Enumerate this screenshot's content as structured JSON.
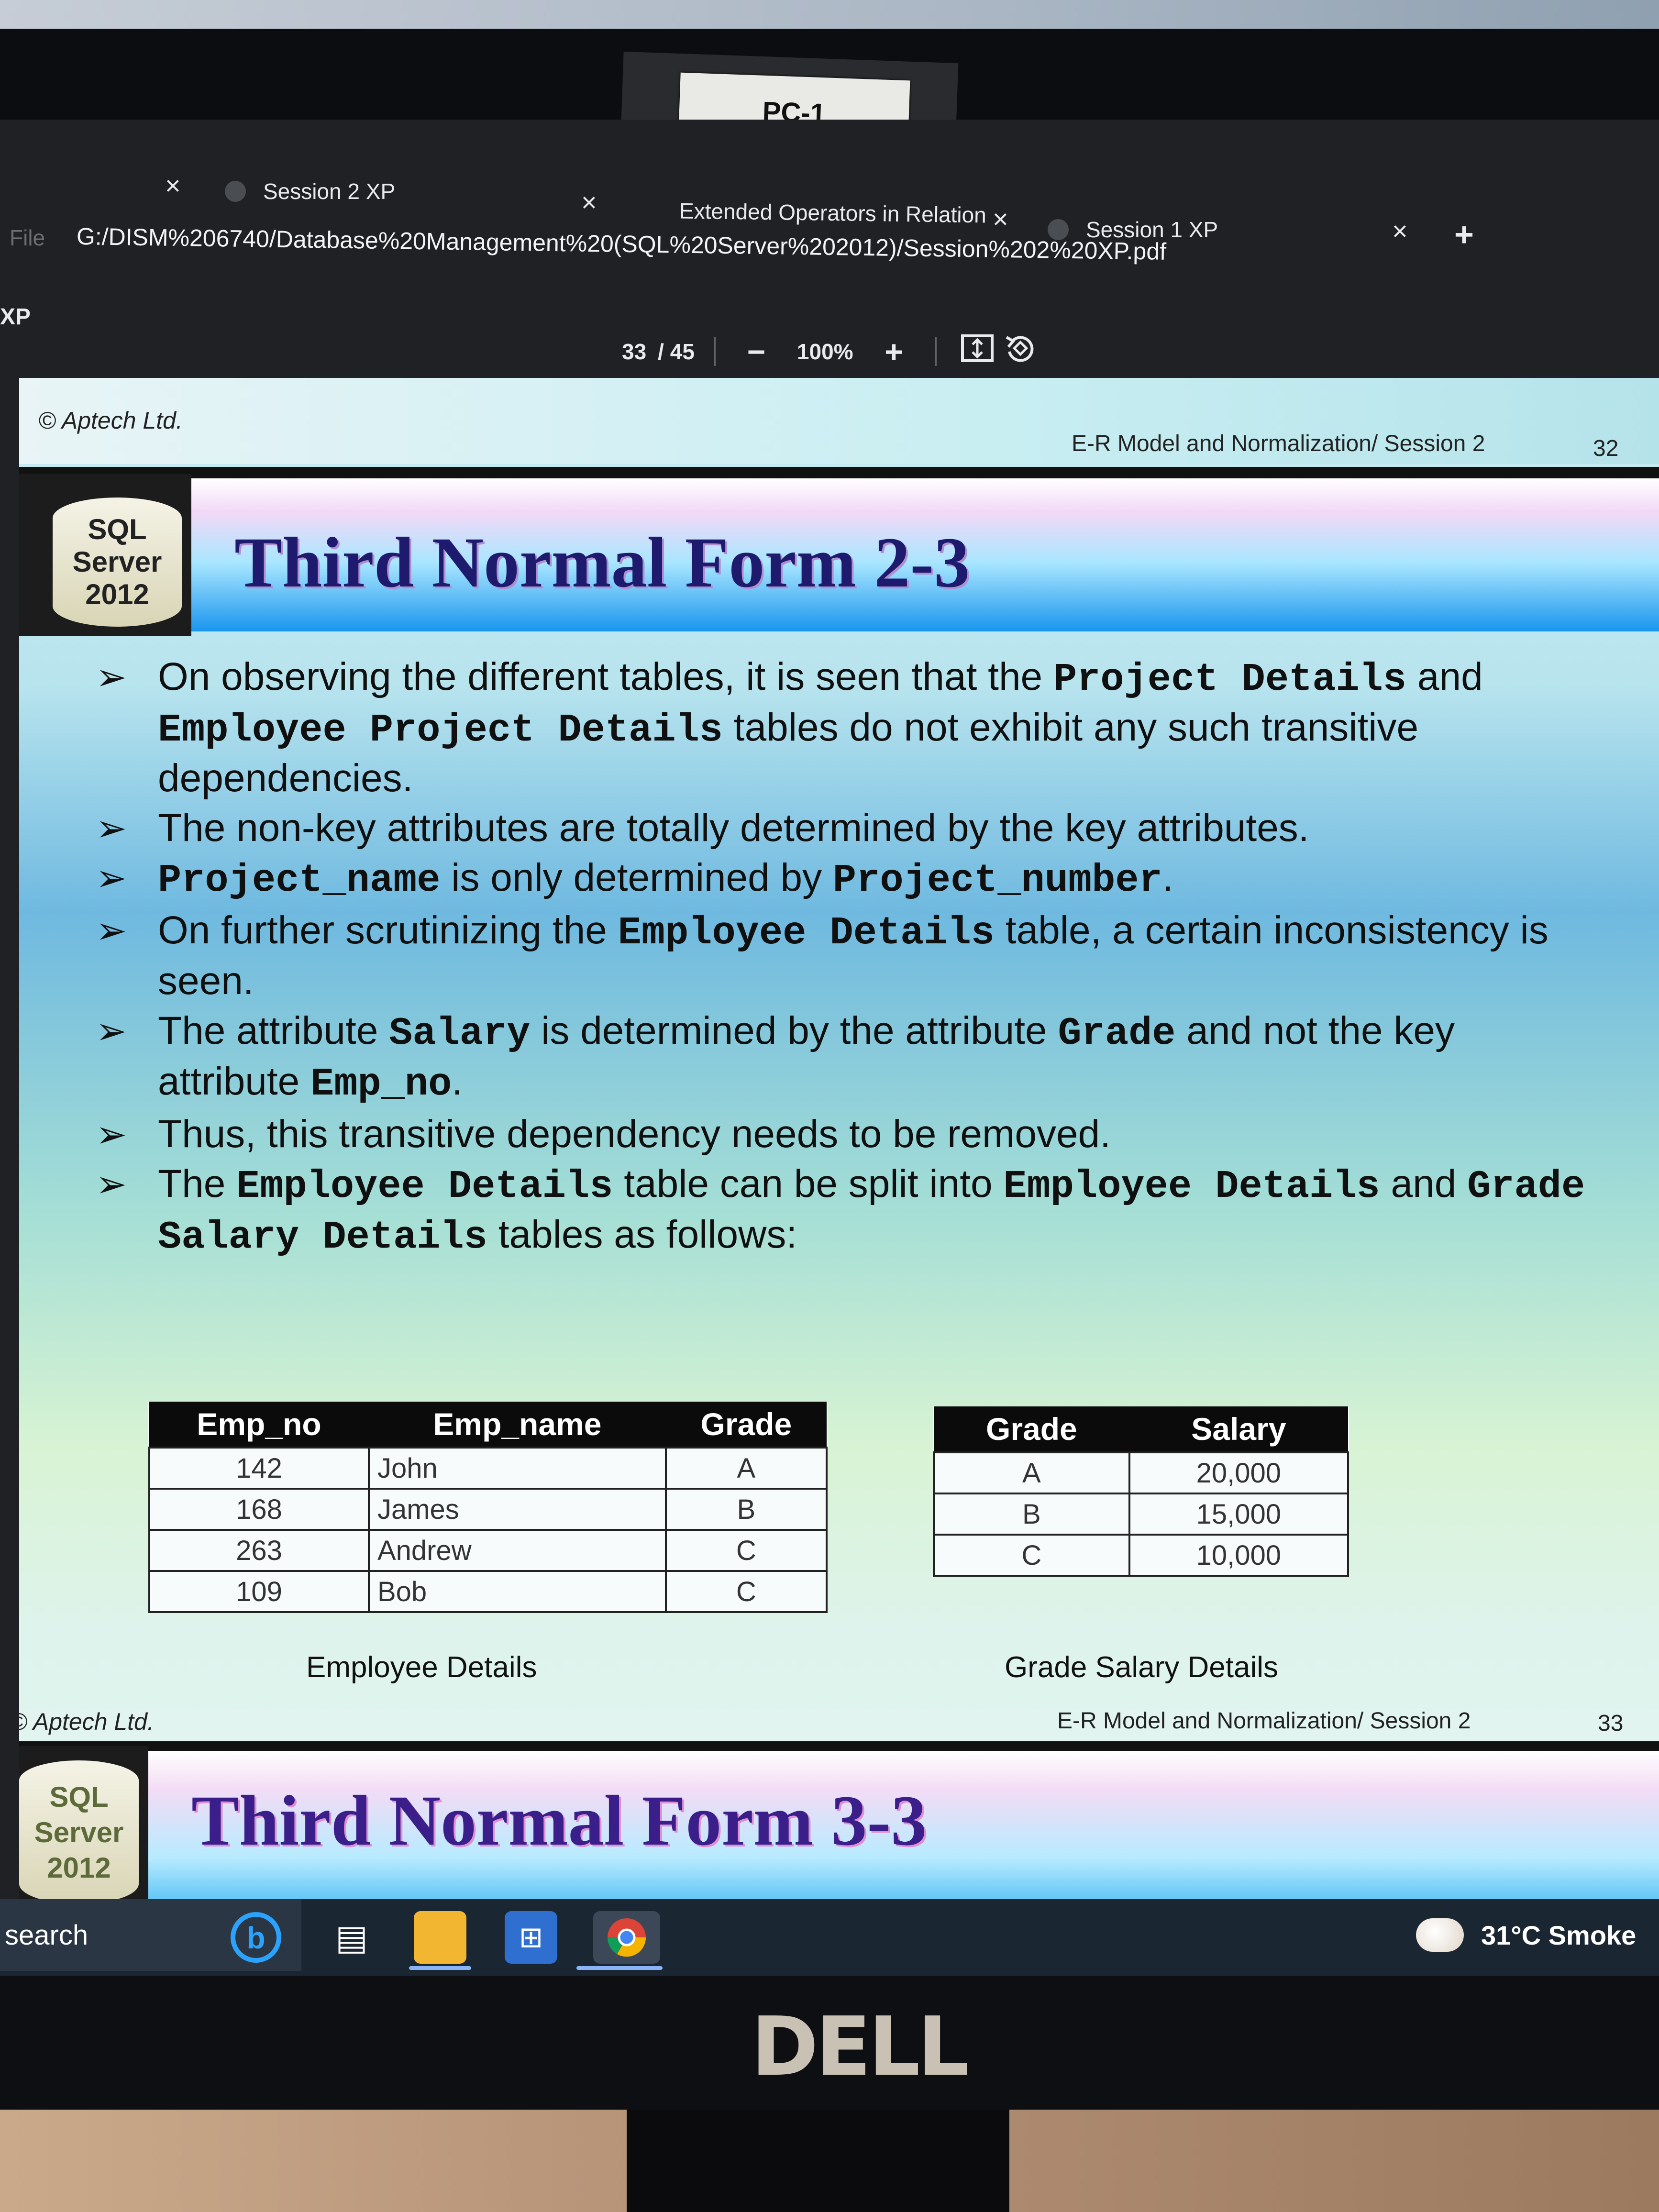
{
  "monitor": {
    "sticker": "PC-1",
    "brand": "DELL"
  },
  "browser": {
    "tabs": [
      {
        "label": "Session 2 XP"
      },
      {
        "label": "Extended Operators in Relation"
      },
      {
        "label": "Session 1 XP"
      }
    ],
    "address_prefix": "File",
    "address": "G:/DISM%206740/Database%20Management%20(SQL%20Server%202012)/Session%202%20XP.pdf",
    "doc_title": "XP"
  },
  "pdf_toolbar": {
    "page_current": "33",
    "page_total": "/ 45",
    "zoom": "100%"
  },
  "page_prev_footer": {
    "copyright": "© Aptech Ltd.",
    "title": "E-R Model and Normalization/ Session 2",
    "page": "32"
  },
  "slide": {
    "logo": [
      "SQL",
      "Server",
      "2012"
    ],
    "title": "Third Normal Form 2-3",
    "bullets": [
      [
        {
          "t": "On observing the different tables, it is seen that the "
        },
        {
          "c": "Project Details"
        },
        {
          "t": " and "
        },
        {
          "c": "Employee Project Details"
        },
        {
          "t": " tables do not exhibit any such transitive dependencies."
        }
      ],
      [
        {
          "t": "The non-key attributes are totally determined by the key attributes."
        }
      ],
      [
        {
          "c": "Project_name"
        },
        {
          "t": " is only determined by "
        },
        {
          "c": "Project_number"
        },
        {
          "t": "."
        }
      ],
      [
        {
          "t": "On further scrutinizing the "
        },
        {
          "c": "Employee Details"
        },
        {
          "t": " table, a certain inconsistency is seen."
        }
      ],
      [
        {
          "t": "The attribute "
        },
        {
          "c": "Salary"
        },
        {
          "t": " is determined by the attribute "
        },
        {
          "c": "Grade"
        },
        {
          "t": " and not the key attribute "
        },
        {
          "c": "Emp_no"
        },
        {
          "t": "."
        }
      ],
      [
        {
          "t": "Thus, this transitive dependency needs to be removed."
        }
      ],
      [
        {
          "t": "The "
        },
        {
          "c": "Employee Details"
        },
        {
          "t": " table can be split into "
        },
        {
          "c": "Employee Details"
        },
        {
          "t": " and "
        },
        {
          "c": "Grade Salary Details"
        },
        {
          "t": " tables as follows:"
        }
      ]
    ],
    "employee_table": {
      "headers": [
        "Emp_no",
        "Emp_name",
        "Grade"
      ],
      "rows": [
        [
          "142",
          "John",
          "A"
        ],
        [
          "168",
          "James",
          "B"
        ],
        [
          "263",
          "Andrew",
          "C"
        ],
        [
          "109",
          "Bob",
          "C"
        ]
      ],
      "caption": "Employee Details"
    },
    "grade_table": {
      "headers": [
        "Grade",
        "Salary"
      ],
      "rows": [
        [
          "A",
          "20,000"
        ],
        [
          "B",
          "15,000"
        ],
        [
          "C",
          "10,000"
        ]
      ],
      "caption": "Grade Salary Details"
    },
    "footer": {
      "copyright": "© Aptech Ltd.",
      "title": "E-R Model and Normalization/ Session 2",
      "page": "33"
    }
  },
  "next_slide": {
    "logo": [
      "SQL",
      "Server",
      "2012"
    ],
    "title": "Third Normal Form 3-3"
  },
  "taskbar": {
    "search": "search",
    "weather": "31°C  Smoke"
  }
}
